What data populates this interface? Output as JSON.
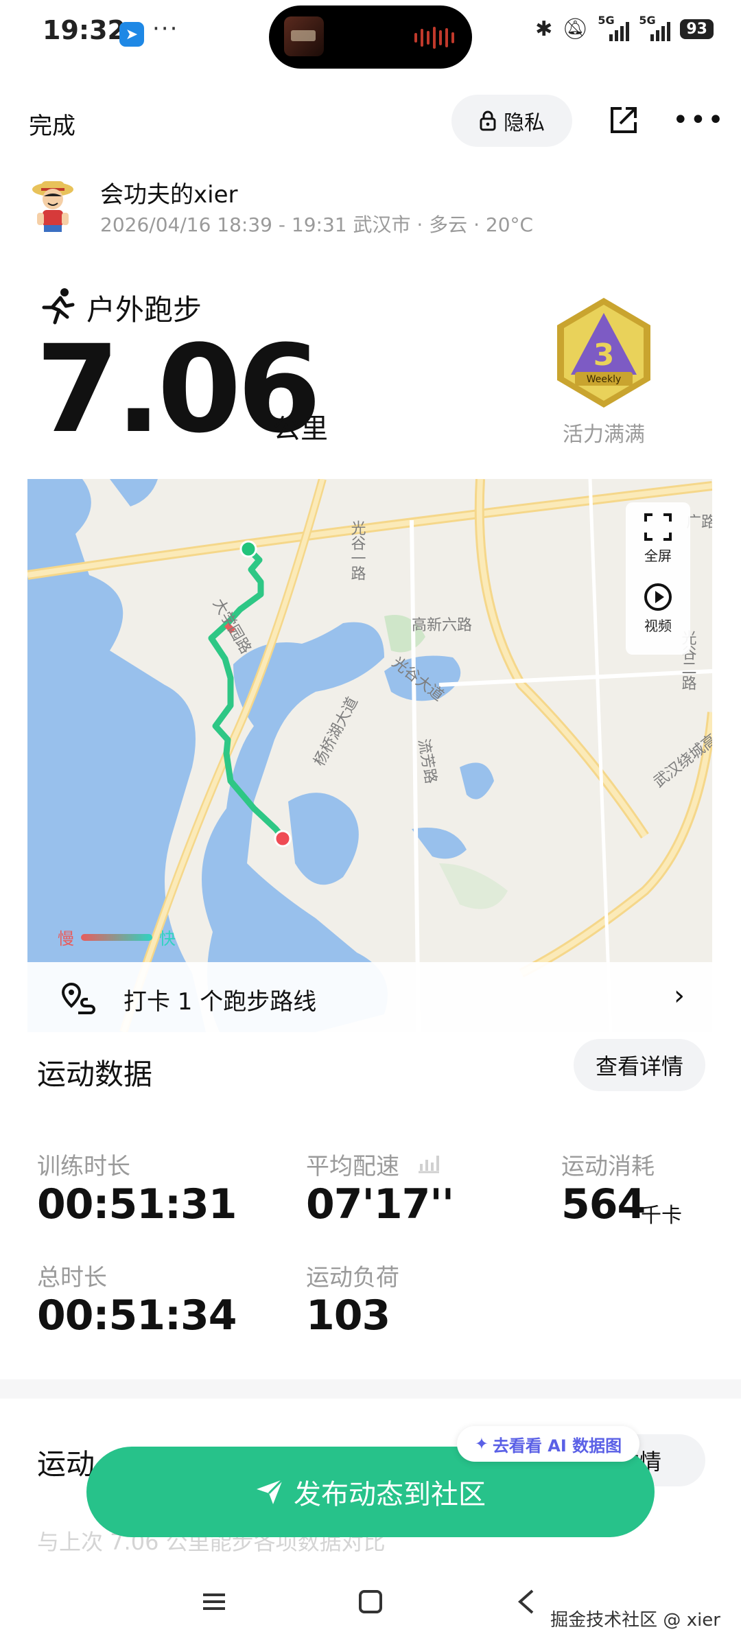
{
  "status_bar": {
    "time": "19:32",
    "more": "···",
    "network_1": "5G",
    "network_2": "5G",
    "battery": "93"
  },
  "header": {
    "done_label": "完成",
    "privacy_label": "隐私"
  },
  "user": {
    "name": "会功夫的xier",
    "meta": "2026/04/16 18:39 - 19:31 武汉市 · 多云 · 20°C"
  },
  "activity": {
    "type": "户外跑步",
    "distance": "7.06",
    "distance_unit": "公里",
    "badge_label": "活力满满",
    "badge_text": "Weekly"
  },
  "map": {
    "fullscreen_label": "全屏",
    "video_label": "视频",
    "legend_slow": "慢",
    "legend_fast": "快",
    "checkin_text": "打卡 1 个跑步路线",
    "road_labels": [
      "光谷一路",
      "大学园路",
      "高新六路",
      "光谷大道",
      "流芳路",
      "杨桥湖大道",
      "武汉绕城高",
      "光谷二路",
      "广路"
    ]
  },
  "stats": {
    "section_title": "运动数据",
    "details_label": "查看详情",
    "items": [
      {
        "label": "训练时长",
        "value": "00:51:31"
      },
      {
        "label": "平均配速",
        "value": "07'17''"
      },
      {
        "label": "运动消耗",
        "value": "564",
        "unit": "千卡"
      },
      {
        "label": "总时长",
        "value": "00:51:34"
      },
      {
        "label": "运动负荷",
        "value": "103"
      }
    ]
  },
  "second_section": {
    "title": "运动",
    "details_label": "详情",
    "faded_text": "与上次 7.06 公里能步各项数据对比"
  },
  "ai_chip_label": "去看看 AI 数据图",
  "publish_label": "发布动态到社区",
  "watermark": "掘金技术社区 @ xier",
  "colors": {
    "accent_green": "#27c28a",
    "route_green": "#2ec785",
    "start_dot": "#22c47c",
    "end_dot": "#ef4b55",
    "water": "#98c0ec"
  }
}
